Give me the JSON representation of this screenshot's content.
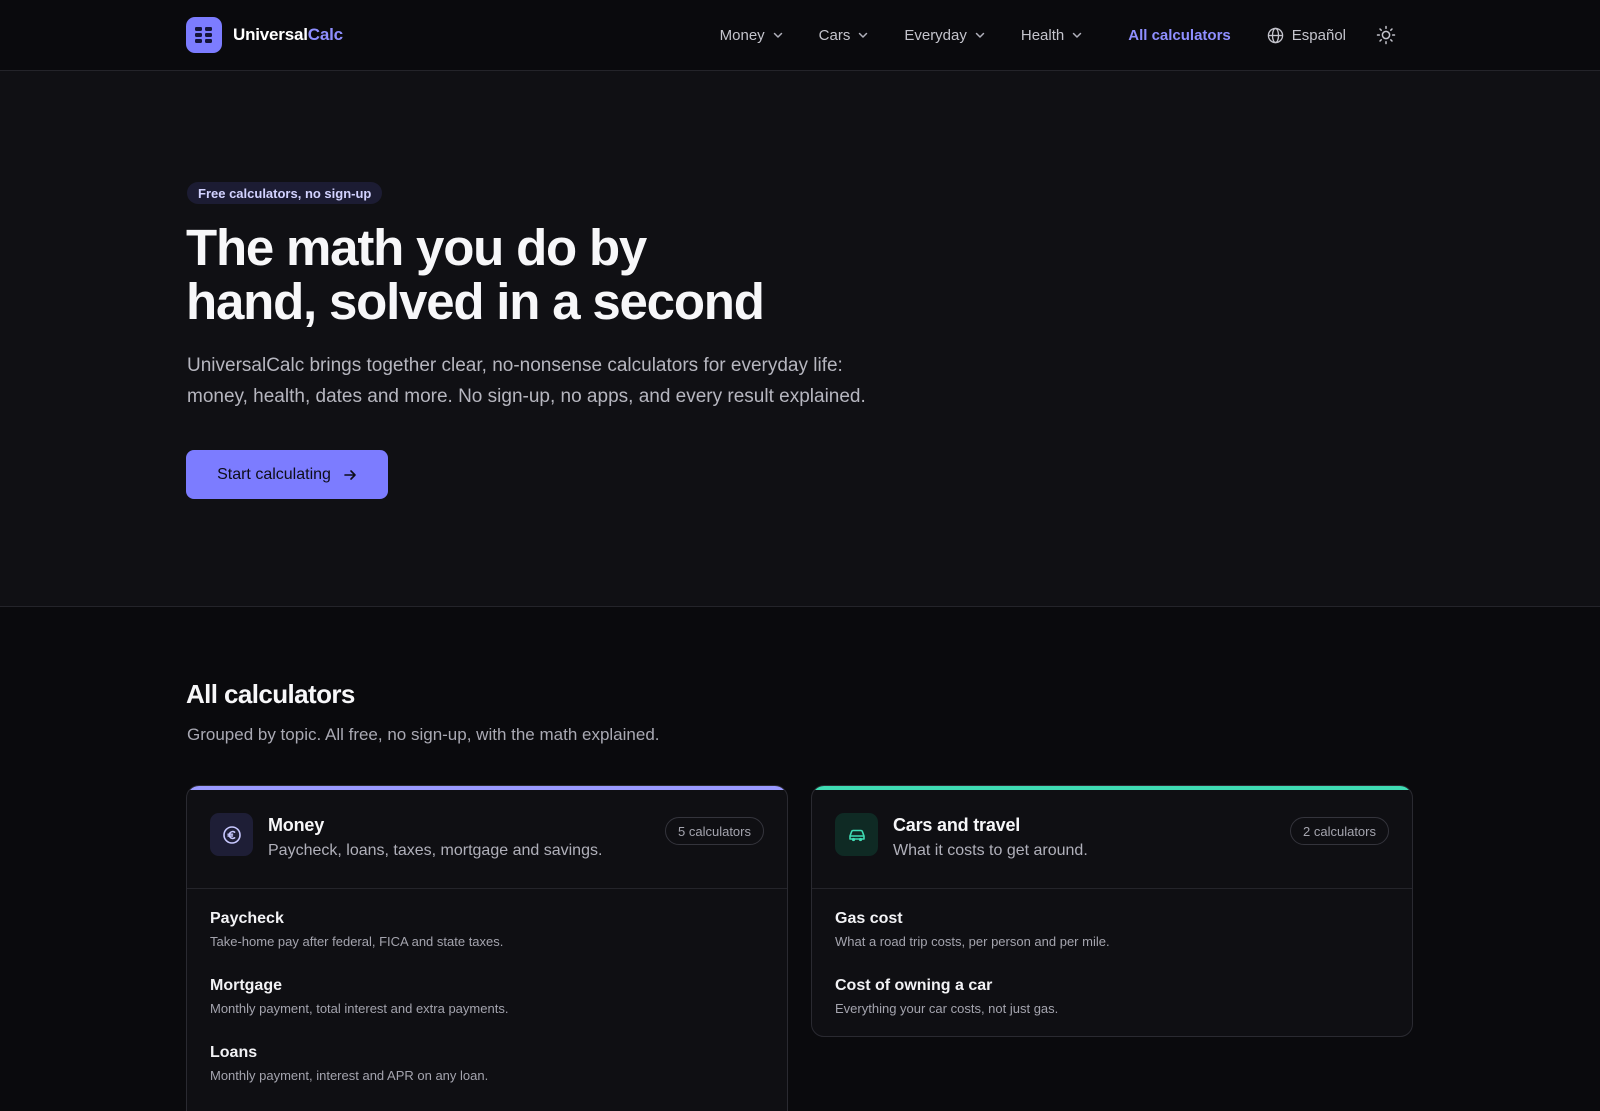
{
  "brand": {
    "name_part1": "Universal",
    "name_part2": "Calc",
    "logo_icon": "grid-icon"
  },
  "nav": {
    "items": [
      {
        "label": "Money",
        "icon": "chevron-down-icon"
      },
      {
        "label": "Cars",
        "icon": "chevron-down-icon"
      },
      {
        "label": "Everyday",
        "icon": "chevron-down-icon"
      },
      {
        "label": "Health",
        "icon": "chevron-down-icon"
      }
    ],
    "all_calculators": "All calculators",
    "language": "Español",
    "language_icon": "globe-icon",
    "theme_icon": "sun-icon"
  },
  "hero": {
    "badge": "Free calculators, no sign-up",
    "title_line1": "The math you do by",
    "title_line2": "hand, solved in a second",
    "subtitle_line1": "UniversalCalc brings together clear, no-nonsense calculators for everyday life:",
    "subtitle_line2": "money, health, dates and more. No sign-up, no apps, and every result explained.",
    "cta_label": "Start calculating",
    "cta_icon": "arrow-right-icon"
  },
  "all_calculators": {
    "title": "All calculators",
    "subtitle": "Grouped by topic. All free, no sign-up, with the math explained.",
    "cards": [
      {
        "title": "Money",
        "description": "Paycheck, loans, taxes, mortgage and savings.",
        "count": "5 calculators",
        "icon": "euro-coin-icon",
        "accent_color": "#9a9aff",
        "items": [
          {
            "name": "Paycheck",
            "description": "Take-home pay after federal, FICA and state taxes."
          },
          {
            "name": "Mortgage",
            "description": "Monthly payment, total interest and extra payments."
          },
          {
            "name": "Loans",
            "description": "Monthly payment, interest and APR on any loan."
          }
        ]
      },
      {
        "title": "Cars and travel",
        "description": "What it costs to get around.",
        "count": "2 calculators",
        "icon": "car-icon",
        "accent_color": "#3fdcb3",
        "items": [
          {
            "name": "Gas cost",
            "description": "What a road trip costs, per person and per mile."
          },
          {
            "name": "Cost of owning a car",
            "description": "Everything your car costs, not just gas."
          }
        ]
      }
    ]
  },
  "colors": {
    "accent": "#7c7cff",
    "accent_link": "#8f8fff",
    "teal": "#3fdcb3",
    "background": "#0a0a0d",
    "hero_background": "#101014"
  }
}
